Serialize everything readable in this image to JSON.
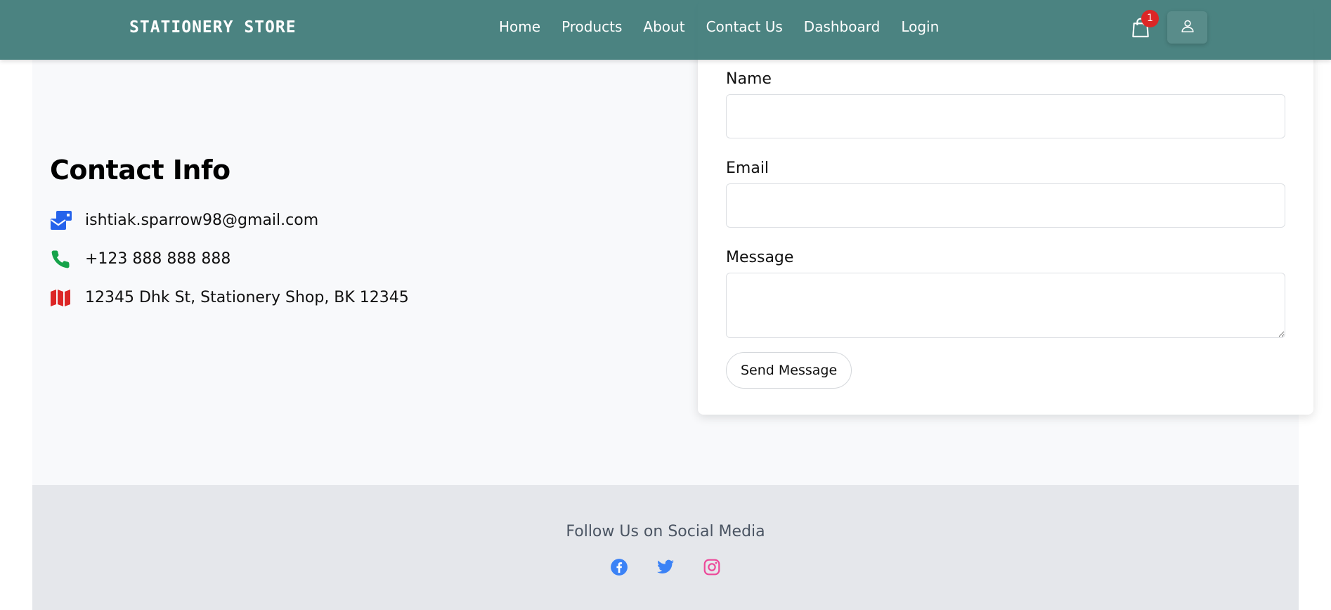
{
  "navbar": {
    "brand": "STATIONERY STORE",
    "links": [
      "Home",
      "Products",
      "About",
      "Contact Us",
      "Dashboard",
      "Login"
    ],
    "cart_count": "1",
    "background_color": "#3d7a77"
  },
  "contact": {
    "heading": "Contact Info",
    "email": "ishtiak.sparrow98@gmail.com",
    "phone": "+123 888 888 888",
    "address": "12345 Dhk St, Stationery Shop, BK 12345",
    "icons": [
      "mail-icon",
      "phone-icon",
      "map-icon"
    ],
    "icon_colors": {
      "mail": "#2563eb",
      "phone": "#16a34a",
      "map": "#dc2626"
    }
  },
  "form": {
    "name_label": "Name",
    "name_value": "",
    "email_label": "Email",
    "email_value": "",
    "message_label": "Message",
    "message_value": "",
    "submit_label": "Send Message"
  },
  "footer": {
    "title": "Follow Us on Social Media",
    "socials": [
      "facebook-icon",
      "twitter-icon",
      "instagram-icon"
    ],
    "social_colors": {
      "facebook": "#3b82f6",
      "twitter": "#3b82f6",
      "instagram": "#ec4899"
    }
  }
}
